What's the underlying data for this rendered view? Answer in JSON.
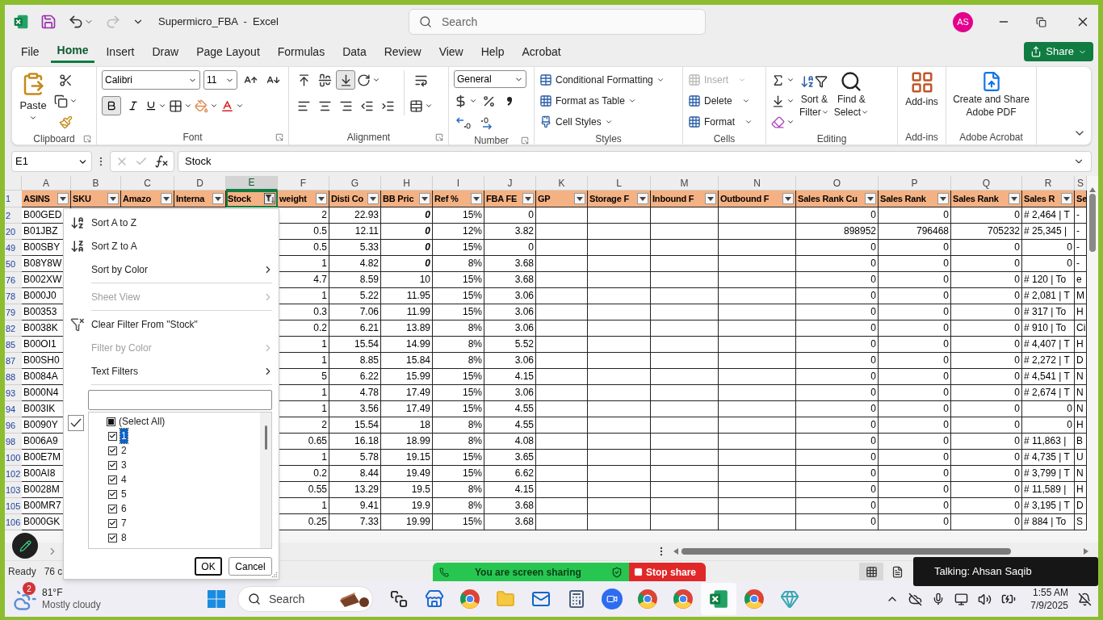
{
  "window": {
    "title": "Supermicro_FBA  -  Excel",
    "search_placeholder": "Search",
    "user_initials": "AS"
  },
  "ribbon_tabs": [
    {
      "label": "File",
      "selected": false
    },
    {
      "label": "Home",
      "selected": true
    },
    {
      "label": "Insert",
      "selected": false
    },
    {
      "label": "Draw",
      "selected": false
    },
    {
      "label": "Page Layout",
      "selected": false
    },
    {
      "label": "Formulas",
      "selected": false
    },
    {
      "label": "Data",
      "selected": false
    },
    {
      "label": "Review",
      "selected": false
    },
    {
      "label": "View",
      "selected": false
    },
    {
      "label": "Help",
      "selected": false
    },
    {
      "label": "Acrobat",
      "selected": false
    }
  ],
  "share_button": "Share",
  "clipboard": {
    "title": "Clipboard",
    "paste": "Paste"
  },
  "font": {
    "title": "Font",
    "name": "Calibri",
    "size": "11",
    "bold": true
  },
  "alignment": {
    "title": "Alignment",
    "bottom_aligned": true
  },
  "number": {
    "title": "Number",
    "format": "General"
  },
  "styles": {
    "title": "Styles",
    "items": [
      "Conditional Formatting",
      "Format as Table",
      "Cell Styles"
    ]
  },
  "cells": {
    "title": "Cells",
    "items": [
      {
        "label": "Insert",
        "disabled": true
      },
      {
        "label": "Delete",
        "disabled": false
      },
      {
        "label": "Format",
        "disabled": false
      }
    ]
  },
  "editing": {
    "title": "Editing",
    "sort_filter": [
      "Sort &",
      "Filter"
    ],
    "find_select": [
      "Find &",
      "Select"
    ]
  },
  "addins": {
    "title": "Add-ins",
    "button": "Add-ins"
  },
  "acrobat": {
    "title": "Adobe Acrobat",
    "button": [
      "Create and Share",
      "Adobe PDF"
    ]
  },
  "formula_bar": {
    "name_box": "E1",
    "value": "Stock"
  },
  "sheet": {
    "columns": [
      {
        "letter": "A",
        "header": "ASINS",
        "selected": false,
        "filtered": false
      },
      {
        "letter": "B",
        "header": "SKU",
        "selected": false,
        "filtered": false
      },
      {
        "letter": "C",
        "header": "Amazo",
        "selected": false,
        "filtered": false
      },
      {
        "letter": "D",
        "header": "Interna",
        "selected": false,
        "filtered": false
      },
      {
        "letter": "E",
        "header": "Stock",
        "selected": true,
        "filtered": true
      },
      {
        "letter": "F",
        "header": "weight",
        "selected": false,
        "filtered": false
      },
      {
        "letter": "G",
        "header": "Disti Co",
        "selected": false,
        "filtered": false
      },
      {
        "letter": "H",
        "header": "BB Pric",
        "selected": false,
        "filtered": false
      },
      {
        "letter": "I",
        "header": "Ref %",
        "selected": false,
        "filtered": false
      },
      {
        "letter": "J",
        "header": "FBA FE",
        "selected": false,
        "filtered": false
      },
      {
        "letter": "K",
        "header": "GP",
        "selected": false,
        "filtered": false
      },
      {
        "letter": "L",
        "header": "Storage F",
        "selected": false,
        "filtered": false
      },
      {
        "letter": "M",
        "header": "Inbound F",
        "selected": false,
        "filtered": false
      },
      {
        "letter": "N",
        "header": "Outbound F",
        "selected": false,
        "filtered": false
      },
      {
        "letter": "O",
        "header": "Sales Rank Cu",
        "selected": false,
        "filtered": false
      },
      {
        "letter": "P",
        "header": "Sales Rank",
        "selected": false,
        "filtered": false
      },
      {
        "letter": "Q",
        "header": "Sales Rank",
        "selected": false,
        "filtered": false
      },
      {
        "letter": "R",
        "header": "Sales R",
        "selected": false,
        "filtered": false
      },
      {
        "letter": "S",
        "header": "Se",
        "selected": false
      }
    ],
    "header_row_num": "1",
    "rows": [
      {
        "num": "2",
        "a": "B00GED",
        "f": "2",
        "g": "22.93",
        "h": "0",
        "h_emphasis": true,
        "i": "15%",
        "j": "0",
        "o": "0",
        "p": "0",
        "q": "0",
        "r": {
          "text": "# 2,464 | T",
          "kind": "text"
        },
        "s": "-"
      },
      {
        "num": "20",
        "a": "B01JBZ",
        "f": "0.5",
        "g": "12.11",
        "h": "0",
        "h_emphasis": true,
        "i": "12%",
        "j": "3.82",
        "o": "898952",
        "p": "796468",
        "q": "705232",
        "r": {
          "text": "# 25,345 |",
          "kind": "text"
        },
        "s": "-"
      },
      {
        "num": "49",
        "a": "B00SBY",
        "f": "0.5",
        "g": "5.33",
        "h": "0",
        "h_emphasis": true,
        "i": "15%",
        "j": "0",
        "o": "0",
        "p": "0",
        "q": "0",
        "r": {
          "text": "0",
          "kind": "number"
        },
        "s": "-"
      },
      {
        "num": "50",
        "a": "B08Y8W",
        "f": "1",
        "g": "4.82",
        "h": "0",
        "h_emphasis": true,
        "i": "8%",
        "j": "3.68",
        "o": "0",
        "p": "0",
        "q": "0",
        "r": {
          "text": "0",
          "kind": "number"
        },
        "s": "-"
      },
      {
        "num": "76",
        "a": "B002XW",
        "f": "4.7",
        "g": "8.59",
        "h": "10",
        "h_emphasis": false,
        "i": "15%",
        "j": "3.68",
        "o": "0",
        "p": "0",
        "q": "0",
        "r": {
          "text": "# 120 | To",
          "kind": "text"
        },
        "s": "e"
      },
      {
        "num": "78",
        "a": "B000J0",
        "f": "1",
        "g": "5.22",
        "h": "11.95",
        "h_emphasis": false,
        "i": "15%",
        "j": "3.06",
        "o": "0",
        "p": "0",
        "q": "0",
        "r": {
          "text": "# 2,081 | T",
          "kind": "text"
        },
        "s": "M"
      },
      {
        "num": "79",
        "a": "B00353",
        "f": "0.3",
        "g": "7.06",
        "h": "11.99",
        "h_emphasis": false,
        "i": "15%",
        "j": "3.06",
        "o": "0",
        "p": "0",
        "q": "0",
        "r": {
          "text": "# 317 | To",
          "kind": "text"
        },
        "s": "H"
      },
      {
        "num": "82",
        "a": "B0038K",
        "f": "0.2",
        "g": "6.21",
        "h": "13.89",
        "h_emphasis": false,
        "i": "8%",
        "j": "3.06",
        "o": "0",
        "p": "0",
        "q": "0",
        "r": {
          "text": "# 910 | To",
          "kind": "text"
        },
        "s": "Ci"
      },
      {
        "num": "85",
        "a": "B00OI1",
        "f": "1",
        "g": "15.54",
        "h": "14.99",
        "h_emphasis": false,
        "i": "8%",
        "j": "5.52",
        "o": "0",
        "p": "0",
        "q": "0",
        "r": {
          "text": "# 4,407 | T",
          "kind": "text"
        },
        "s": "H"
      },
      {
        "num": "87",
        "a": "B00SH0",
        "f": "1",
        "g": "8.85",
        "h": "15.84",
        "h_emphasis": false,
        "i": "8%",
        "j": "3.06",
        "o": "0",
        "p": "0",
        "q": "0",
        "r": {
          "text": "# 2,272 | T",
          "kind": "text"
        },
        "s": "D"
      },
      {
        "num": "88",
        "a": "B0084A",
        "f": "5",
        "g": "6.22",
        "h": "15.99",
        "h_emphasis": false,
        "i": "15%",
        "j": "4.15",
        "o": "0",
        "p": "0",
        "q": "0",
        "r": {
          "text": "# 4,541 | T",
          "kind": "text"
        },
        "s": "N"
      },
      {
        "num": "93",
        "a": "B000N4",
        "f": "1",
        "g": "4.78",
        "h": "17.49",
        "h_emphasis": false,
        "i": "15%",
        "j": "3.06",
        "o": "0",
        "p": "0",
        "q": "0",
        "r": {
          "text": "# 2,674 | T",
          "kind": "text"
        },
        "s": "N"
      },
      {
        "num": "94",
        "a": "B003IK",
        "f": "1",
        "g": "3.56",
        "h": "17.49",
        "h_emphasis": false,
        "i": "15%",
        "j": "4.55",
        "o": "0",
        "p": "0",
        "q": "0",
        "r": {
          "text": "0",
          "kind": "number"
        },
        "s": "N"
      },
      {
        "num": "96",
        "a": "B0090Y",
        "f": "2",
        "g": "15.54",
        "h": "18",
        "h_emphasis": false,
        "i": "8%",
        "j": "4.55",
        "o": "0",
        "p": "0",
        "q": "0",
        "r": {
          "text": "0",
          "kind": "number"
        },
        "s": "H"
      },
      {
        "num": "98",
        "a": "B006A9",
        "f": "0.65",
        "g": "16.18",
        "h": "18.99",
        "h_emphasis": false,
        "i": "8%",
        "j": "4.08",
        "o": "0",
        "p": "0",
        "q": "0",
        "r": {
          "text": "# 11,863 |",
          "kind": "text"
        },
        "s": "B"
      },
      {
        "num": "100",
        "a": "B00E7M",
        "f": "1",
        "g": "5.78",
        "h": "19.15",
        "h_emphasis": false,
        "i": "15%",
        "j": "3.65",
        "o": "0",
        "p": "0",
        "q": "0",
        "r": {
          "text": "# 4,735 | T",
          "kind": "text"
        },
        "s": "U"
      },
      {
        "num": "102",
        "a": "B00AI8",
        "f": "0.2",
        "g": "8.44",
        "h": "19.49",
        "h_emphasis": false,
        "i": "15%",
        "j": "6.62",
        "o": "0",
        "p": "0",
        "q": "0",
        "r": {
          "text": "# 3,799 | T",
          "kind": "text"
        },
        "s": "N"
      },
      {
        "num": "103",
        "a": "B0028M",
        "f": "0.55",
        "g": "13.29",
        "h": "19.5",
        "h_emphasis": false,
        "i": "8%",
        "j": "4.15",
        "o": "0",
        "p": "0",
        "q": "0",
        "r": {
          "text": "# 11,589 |",
          "kind": "text"
        },
        "s": "H"
      },
      {
        "num": "105",
        "a": "B00MR7",
        "f": "1",
        "g": "9.41",
        "h": "19.9",
        "h_emphasis": false,
        "i": "8%",
        "j": "3.68",
        "o": "0",
        "p": "0",
        "q": "0",
        "r": {
          "text": "# 3,195 | T",
          "kind": "text"
        },
        "s": "D"
      },
      {
        "num": "106",
        "a": "B000GK",
        "f": "0.25",
        "g": "7.33",
        "h": "19.99",
        "h_emphasis": false,
        "i": "15%",
        "j": "3.68",
        "o": "0",
        "p": "0",
        "q": "0",
        "r": {
          "text": "# 884 | To",
          "kind": "text"
        },
        "s": "S"
      }
    ]
  },
  "filter_menu": {
    "items": [
      {
        "kind": "sort_asc",
        "label": "Sort A to Z",
        "disabled": false,
        "submenu": false
      },
      {
        "kind": "sort_desc",
        "label": "Sort Z to A",
        "disabled": false,
        "submenu": false
      },
      {
        "kind": "item",
        "label": "Sort by Color",
        "disabled": false,
        "submenu": true
      },
      {
        "kind": "separator"
      },
      {
        "kind": "item",
        "label": "Sheet View",
        "disabled": true,
        "submenu": true
      },
      {
        "kind": "separator"
      },
      {
        "kind": "clear_filter",
        "label": "Clear Filter From \"Stock\"",
        "disabled": false,
        "submenu": false
      },
      {
        "kind": "item",
        "label": "Filter by Color",
        "disabled": true,
        "submenu": true
      },
      {
        "kind": "item",
        "label": "Text Filters",
        "disabled": false,
        "submenu": true
      },
      {
        "kind": "separator"
      }
    ],
    "select_all": {
      "label": "(Select All)",
      "partial": true
    },
    "values": [
      {
        "label": "1",
        "checked": true,
        "selected": true
      },
      {
        "label": "2",
        "checked": true,
        "selected": false
      },
      {
        "label": "3",
        "checked": true,
        "selected": false
      },
      {
        "label": "4",
        "checked": true,
        "selected": false
      },
      {
        "label": "5",
        "checked": true,
        "selected": false
      },
      {
        "label": "6",
        "checked": true,
        "selected": false
      },
      {
        "label": "7",
        "checked": true,
        "selected": false
      },
      {
        "label": "8",
        "checked": true,
        "selected": false
      }
    ],
    "ok": "OK",
    "cancel": "Cancel"
  },
  "status_bar": {
    "ready": "Ready",
    "count": "76 c"
  },
  "screen_share": {
    "message": "You are screen sharing",
    "stop": "Stop share"
  },
  "talking": "Talking: Ahsan Saqib",
  "taskbar": {
    "temperature": "81°F",
    "weather": "Mostly cloudy",
    "badge": "2",
    "search": "Search",
    "time": "1:55 AM",
    "date": "7/9/2025"
  }
}
